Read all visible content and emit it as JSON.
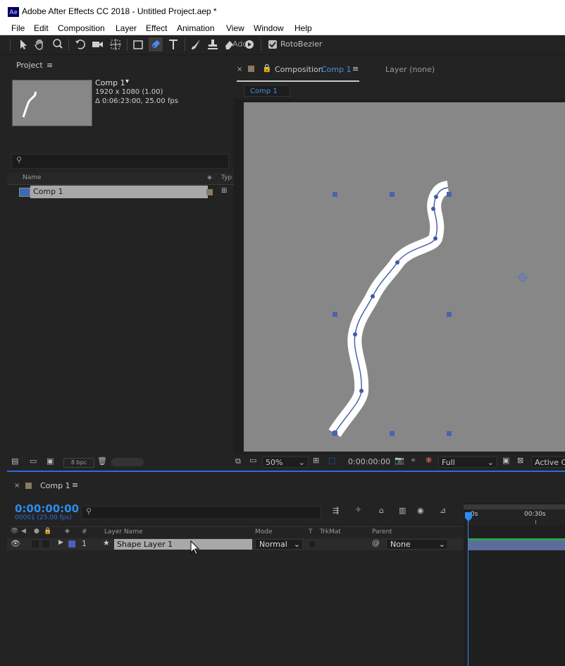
{
  "window": {
    "title": "Adobe After Effects CC 2018 - Untitled Project.aep *",
    "app_icon": "Ae"
  },
  "menu": {
    "items": [
      "File",
      "Edit",
      "Composition",
      "Layer",
      "Effect",
      "Animation",
      "View",
      "Window",
      "Help"
    ]
  },
  "toolbar": {
    "add_label": "Add:",
    "rotobezier_label": "RotoBezier",
    "rotobezier_checked": true,
    "icons": [
      "selection-icon",
      "hand-icon",
      "zoom-icon",
      "rotate-icon",
      "camera-icon",
      "pan-behind-icon",
      "rectangle-icon",
      "pen-icon",
      "type-icon",
      "brush-icon",
      "clone-stamp-icon",
      "eraser-icon",
      "puppet-icon"
    ]
  },
  "project": {
    "tab": "Project",
    "comp_name": "Comp 1",
    "comp_size": "1920 x 1080 (1.00)",
    "comp_duration": "Δ 0:06:23:00, 25.00 fps",
    "columns": {
      "name": "Name",
      "type": "Typ"
    },
    "items": [
      {
        "name": "Comp 1"
      }
    ],
    "bpc": "8 bpc"
  },
  "composition": {
    "tab_prefix": "Composition",
    "tab_comp": "Comp 1",
    "layer_tab": "Layer (none)",
    "subtab": "Comp 1"
  },
  "viewer": {
    "zoom": "50%",
    "timecode": "0:00:00:00",
    "resolution": "Full",
    "camera": "Active C"
  },
  "timeline": {
    "tab": "Comp 1",
    "timecode": "0:00:00:00",
    "frame_info": "00001 (25.00 fps)",
    "columns": {
      "number": "#",
      "layer_name": "Layer Name",
      "mode": "Mode",
      "t": "T",
      "trkmat": "TrkMat",
      "parent": "Parent"
    },
    "layers": [
      {
        "number": "1",
        "name": "Shape Layer 1",
        "mode": "Normal",
        "parent": "None",
        "label_color": "#4a5fc1"
      }
    ],
    "ruler": {
      "start": "0s",
      "mark": "00:30s"
    }
  },
  "colors": {
    "accent": "#2d8ceb",
    "handle": "#4a62b0",
    "path": "#3e5aa8"
  }
}
